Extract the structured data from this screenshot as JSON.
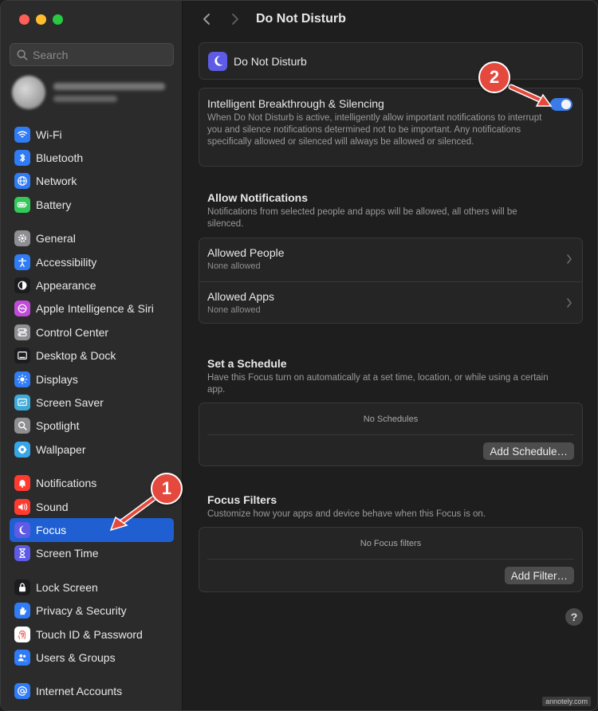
{
  "search": {
    "placeholder": "Search"
  },
  "sidebar": {
    "groups": [
      [
        {
          "label": "Wi-Fi",
          "icon": "wifi-icon",
          "color": "#2f7cf6"
        },
        {
          "label": "Bluetooth",
          "icon": "bluetooth-icon",
          "color": "#2f7cf6"
        },
        {
          "label": "Network",
          "icon": "globe-icon",
          "color": "#2f7cf6"
        },
        {
          "label": "Battery",
          "icon": "battery-icon",
          "color": "#34c759"
        }
      ],
      [
        {
          "label": "General",
          "icon": "gear-icon",
          "color": "#8e8e93"
        },
        {
          "label": "Accessibility",
          "icon": "accessibility-icon",
          "color": "#2f7cf6"
        },
        {
          "label": "Appearance",
          "icon": "appearance-icon",
          "color": "#1c1c1e"
        },
        {
          "label": "Apple Intelligence & Siri",
          "icon": "siri-icon",
          "color": "#c04bd8"
        },
        {
          "label": "Control Center",
          "icon": "control-center-icon",
          "color": "#8e8e93"
        },
        {
          "label": "Desktop & Dock",
          "icon": "dock-icon",
          "color": "#1c1c1e"
        },
        {
          "label": "Displays",
          "icon": "sun-icon",
          "color": "#2f7cf6"
        },
        {
          "label": "Screen Saver",
          "icon": "screen-saver-icon",
          "color": "#3fa9d8"
        },
        {
          "label": "Spotlight",
          "icon": "magnifier-icon",
          "color": "#8e8e93"
        },
        {
          "label": "Wallpaper",
          "icon": "flower-icon",
          "color": "#38a5e6"
        }
      ],
      [
        {
          "label": "Notifications",
          "icon": "bell-icon",
          "color": "#ff3b30"
        },
        {
          "label": "Sound",
          "icon": "speaker-icon",
          "color": "#ff3b30"
        },
        {
          "label": "Focus",
          "icon": "moon-icon",
          "color": "#5e5ce6",
          "active": true
        },
        {
          "label": "Screen Time",
          "icon": "hourglass-icon",
          "color": "#5e5ce6"
        }
      ],
      [
        {
          "label": "Lock Screen",
          "icon": "lock-icon",
          "color": "#1c1c1e"
        },
        {
          "label": "Privacy & Security",
          "icon": "hand-icon",
          "color": "#2f7cf6"
        },
        {
          "label": "Touch ID & Password",
          "icon": "fingerprint-icon",
          "color": "#ffffff"
        },
        {
          "label": "Users & Groups",
          "icon": "users-icon",
          "color": "#2f7cf6"
        }
      ],
      [
        {
          "label": "Internet Accounts",
          "icon": "at-icon",
          "color": "#2f7cf6"
        }
      ]
    ]
  },
  "header": {
    "title": "Do Not Disturb"
  },
  "dnd": {
    "label": "Do Not Disturb"
  },
  "breakthrough": {
    "title": "Intelligent Breakthrough & Silencing",
    "description": "When Do Not Disturb is active, intelligently allow important notifications to interrupt you and silence notifications determined not to be important. Any notifications specifically allowed or silenced will always be allowed or silenced.",
    "enabled": true
  },
  "allow": {
    "title": "Allow Notifications",
    "description": "Notifications from selected people and apps will be allowed, all others will be silenced.",
    "people": {
      "title": "Allowed People",
      "subtitle": "None allowed"
    },
    "apps": {
      "title": "Allowed Apps",
      "subtitle": "None allowed"
    }
  },
  "schedule": {
    "title": "Set a Schedule",
    "description": "Have this Focus turn on automatically at a set time, location, or while using a certain app.",
    "empty": "No Schedules",
    "button": "Add Schedule…"
  },
  "filters": {
    "title": "Focus Filters",
    "description": "Customize how your apps and device behave when this Focus is on.",
    "empty": "No Focus filters",
    "button": "Add Filter…"
  },
  "help": {
    "label": "?"
  },
  "annotations": {
    "step1": "1",
    "step2": "2",
    "color": "#e5493d"
  },
  "watermark": "annotely.com"
}
